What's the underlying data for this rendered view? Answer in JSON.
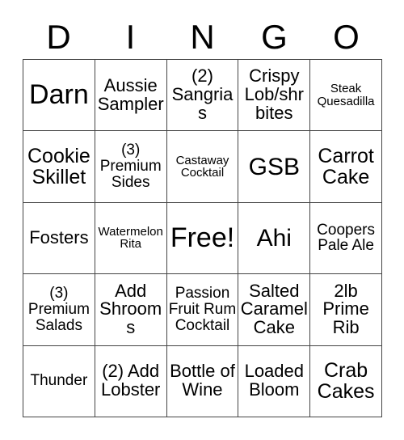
{
  "card": {
    "header_letters": [
      "D",
      "I",
      "N",
      "G",
      "O"
    ],
    "border_color": "#444444",
    "background_color": "#ffffff",
    "text_color": "#000000",
    "rows": [
      [
        {
          "text": "Darn",
          "size": "xxl"
        },
        {
          "text": "Aussie Sampler",
          "size": "md"
        },
        {
          "text": "(2) Sangrias",
          "size": "md"
        },
        {
          "text": "Crispy Lob/shr bites",
          "size": "md"
        },
        {
          "text": "Steak Quesadilla",
          "size": "xs"
        }
      ],
      [
        {
          "text": "Cookie Skillet",
          "size": "lg"
        },
        {
          "text": "(3) Premium Sides",
          "size": "sm"
        },
        {
          "text": "Castaway Cocktail",
          "size": "xs"
        },
        {
          "text": "GSB",
          "size": "xl"
        },
        {
          "text": "Carrot Cake",
          "size": "lg"
        }
      ],
      [
        {
          "text": "Fosters",
          "size": "md"
        },
        {
          "text": "Watermelon Rita",
          "size": "xs"
        },
        {
          "text": "Free!",
          "size": "xxl"
        },
        {
          "text": "Ahi",
          "size": "xl"
        },
        {
          "text": "Coopers Pale Ale",
          "size": "sm"
        }
      ],
      [
        {
          "text": "(3) Premium Salads",
          "size": "sm"
        },
        {
          "text": "Add Shrooms",
          "size": "md"
        },
        {
          "text": "Passion Fruit Rum Cocktail",
          "size": "sm"
        },
        {
          "text": "Salted Caramel Cake",
          "size": "md"
        },
        {
          "text": "2lb Prime Rib",
          "size": "md"
        }
      ],
      [
        {
          "text": "Thunder",
          "size": "sm"
        },
        {
          "text": "(2) Add Lobster",
          "size": "md"
        },
        {
          "text": "Bottle of Wine",
          "size": "md"
        },
        {
          "text": "Loaded Bloom",
          "size": "md"
        },
        {
          "text": "Crab Cakes",
          "size": "lg"
        }
      ]
    ]
  }
}
